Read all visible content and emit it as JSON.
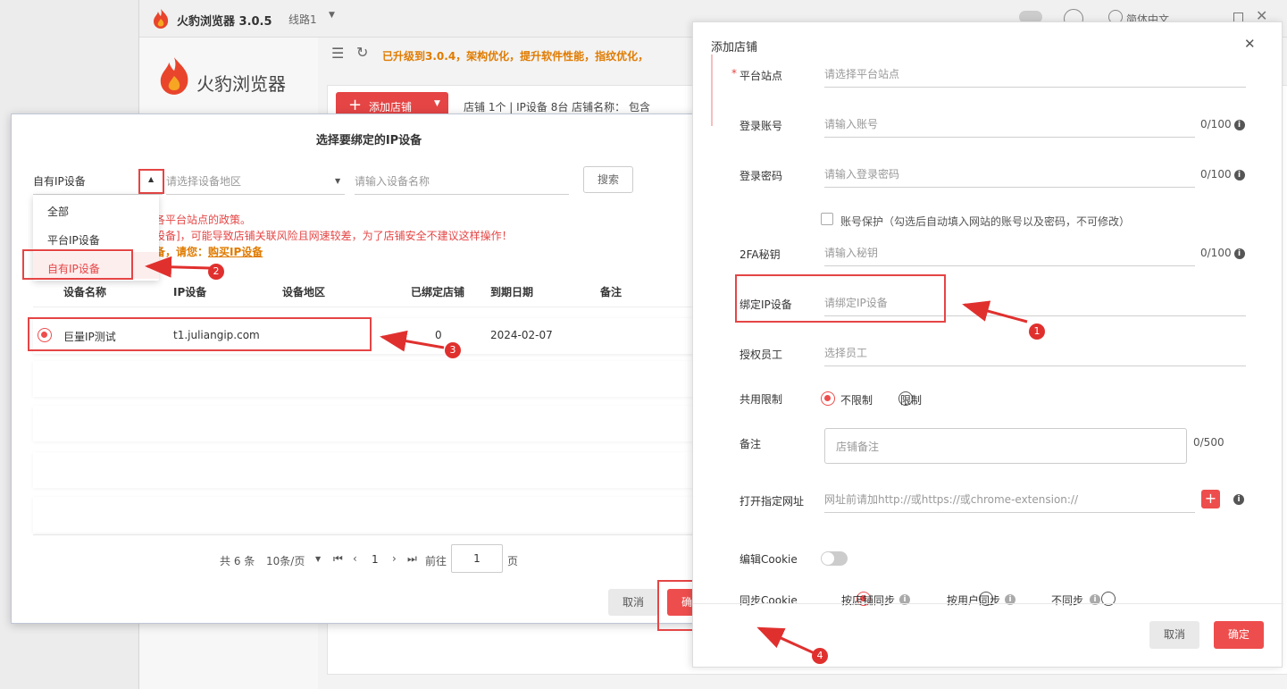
{
  "app": {
    "title": "火豹浏览器 3.0.5",
    "line": "线路1",
    "brand": "火豹浏览器",
    "language": "简体中文",
    "upgrade_notice": "已升级到3.0.4，架构优化，提升软件性能，指纹优化，",
    "add_shop_button": "添加店铺",
    "stats": "店铺 1个 | IP设备 8台  店铺名称： 包含"
  },
  "ip_modal": {
    "title": "选择要绑定的IP设备",
    "type_select": "自有IP设备",
    "region_placeholder": "请选择设备地区",
    "name_placeholder": "请输入设备名称",
    "search_button": "搜索",
    "dropdown_options": [
      "全部",
      "平台IP设备",
      "自有IP设备"
    ],
    "notice_1": "各平台站点的政策。",
    "notice_2": "设备]，可能导致店铺关联风险且网速较差，为了店铺安全不建议这样操作！",
    "notice_3_prefix": "备，请您：",
    "notice_3_link": "购买IP设备",
    "columns": [
      "设备名称",
      "IP设备",
      "设备地区",
      "已绑定店铺",
      "到期日期",
      "备注"
    ],
    "rows": [
      {
        "name": "巨量IP测试",
        "ip": "t1.juliangip.com",
        "region": "",
        "bound": "0",
        "expire": "2024-02-07",
        "note": ""
      }
    ],
    "pagination": {
      "total": "共 6 条",
      "page_size": "10条/页",
      "current": "1",
      "goto_label": "前往",
      "goto_value": "1",
      "page_suffix": "页"
    },
    "cancel_button": "取消",
    "confirm_button": "确定"
  },
  "drawer": {
    "title": "添加店铺",
    "platform_label": "平台站点",
    "platform_placeholder": "请选择平台站点",
    "account_label": "登录账号",
    "account_placeholder": "请输入账号",
    "account_count": "0/100",
    "password_label": "登录密码",
    "password_placeholder": "请输入登录密码",
    "password_count": "0/100",
    "protect_label": "账号保护（勾选后自动填入网站的账号以及密码，不可修改）",
    "twofa_label": "2FA秘钥",
    "twofa_placeholder": "请输入秘钥",
    "twofa_count": "0/100",
    "bind_ip_label": "绑定IP设备",
    "bind_ip_placeholder": "请绑定IP设备",
    "staff_label": "授权员工",
    "staff_placeholder": "选择员工",
    "share_label": "共用限制",
    "share_unlimited": "不限制",
    "share_limited": "限制",
    "note_label": "备注",
    "note_placeholder": "店铺备注",
    "note_count": "0/500",
    "url_label": "打开指定网址",
    "url_placeholder": "网址前请加http://或https://或chrome-extension://",
    "cookie_edit_label": "编辑Cookie",
    "cookie_sync_label": "同步Cookie",
    "sync_by_shop": "按店铺同步",
    "sync_by_user": "按用户同步",
    "sync_none": "不同步",
    "cancel_button": "取消",
    "confirm_button": "确定"
  },
  "annotations": [
    "1",
    "2",
    "3",
    "4"
  ],
  "colors": {
    "accent": "#ee4d4d",
    "highlight": "#e54545",
    "link": "#e07b00"
  }
}
